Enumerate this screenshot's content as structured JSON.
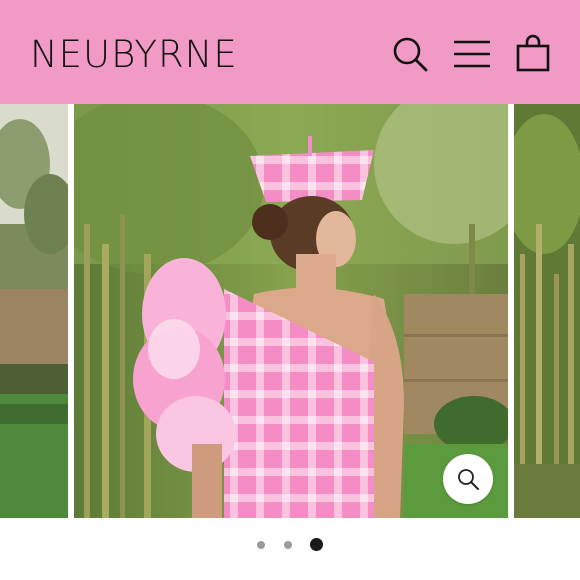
{
  "header": {
    "brand": "NEUBYRNE",
    "background": "#f19ac5",
    "icons": [
      "search-icon",
      "menu-icon",
      "cart-icon"
    ]
  },
  "gallery": {
    "slide_count": 3,
    "active_index": 2,
    "zoom_icon": "zoom-icon"
  },
  "colors": {
    "accent_pink": "#f19ac5",
    "garment_pink": "#f37fbf",
    "active_dot": "#1a1a1a",
    "inactive_dot": "#9a9a9a"
  }
}
